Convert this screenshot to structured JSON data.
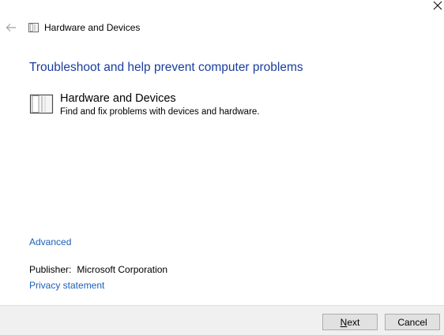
{
  "window": {
    "title": "Hardware and Devices"
  },
  "main": {
    "heading": "Troubleshoot and help prevent computer problems",
    "troubleshooter": {
      "name": "Hardware and Devices",
      "description": "Find and fix problems with devices and hardware.",
      "icon": "hardware-device-icon"
    },
    "advanced_link": "Advanced",
    "publisher_label": "Publisher:",
    "publisher_value": "Microsoft Corporation",
    "privacy_link": "Privacy statement"
  },
  "footer": {
    "next_label_accel": "N",
    "next_label_rest": "ext",
    "cancel_label": "Cancel"
  },
  "colors": {
    "heading": "#1a3e9e",
    "link": "#1b5fb8",
    "footer_bg": "#f0f0f0"
  }
}
